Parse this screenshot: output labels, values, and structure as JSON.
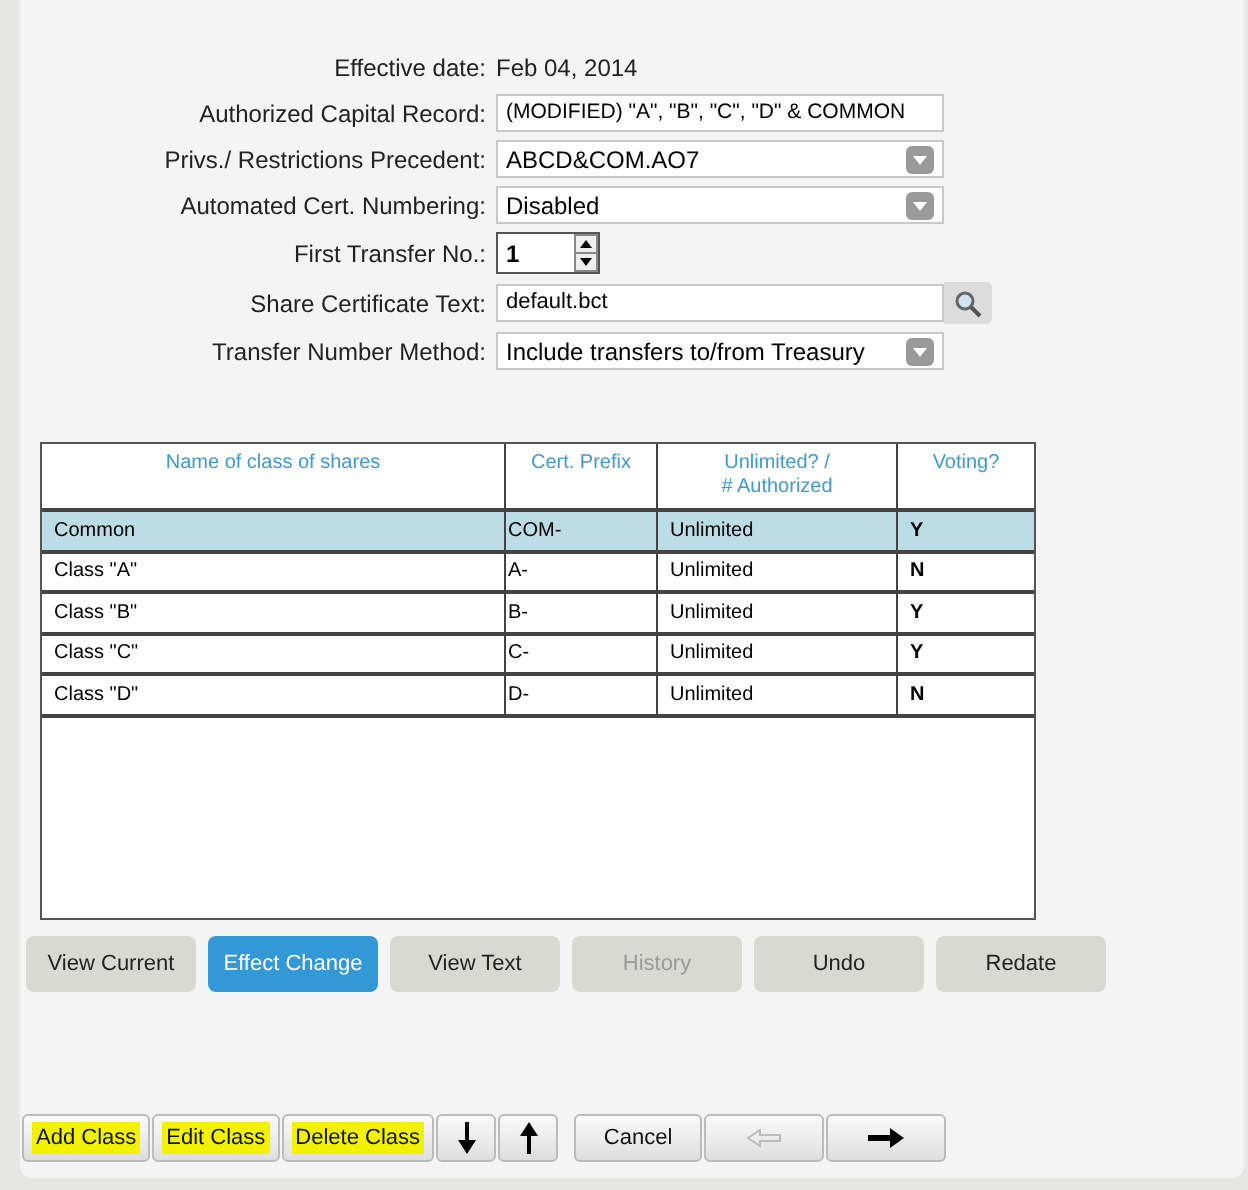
{
  "form": [
    {
      "label": "Effective date:",
      "kind": "static",
      "value": "Feb 04, 2014"
    },
    {
      "label": "Authorized Capital Record:",
      "kind": "text",
      "value": "(MODIFIED) \"A\", \"B\", \"C\", \"D\" & COMMON"
    },
    {
      "label": "Privs./ Restrictions Precedent:",
      "kind": "select",
      "value": "ABCD&COM.AO7"
    },
    {
      "label": "Automated Cert. Numbering:",
      "kind": "select",
      "value": "Disabled"
    },
    {
      "label": "First Transfer No.:",
      "kind": "spinner",
      "value": "1"
    },
    {
      "label": "Share Certificate Text:",
      "kind": "lookup",
      "value": "default.bct"
    },
    {
      "label": "Transfer Number Method:",
      "kind": "select",
      "value": "Include transfers to/from Treasury"
    }
  ],
  "table": {
    "columns": [
      "Name of class of shares",
      "Cert. Prefix",
      "Unlimited? /\n# Authorized",
      "Voting?"
    ],
    "rows": [
      {
        "selected": true,
        "cells": [
          "Common",
          "COM-",
          "Unlimited",
          "Y"
        ]
      },
      {
        "selected": false,
        "cells": [
          "Class \"A\"",
          "A-",
          "Unlimited",
          "N"
        ]
      },
      {
        "selected": false,
        "cells": [
          "Class \"B\"",
          "B-",
          "Unlimited",
          "Y"
        ]
      },
      {
        "selected": false,
        "cells": [
          "Class \"C\"",
          "C-",
          "Unlimited",
          "Y"
        ]
      },
      {
        "selected": false,
        "cells": [
          "Class \"D\"",
          "D-",
          "Unlimited",
          "N"
        ]
      }
    ]
  },
  "actions": [
    {
      "label": "View Current",
      "selected": false,
      "disabled": false
    },
    {
      "label": "Effect Change",
      "selected": true,
      "disabled": false
    },
    {
      "label": "View Text",
      "selected": false,
      "disabled": false
    },
    {
      "label": "History",
      "selected": false,
      "disabled": true
    },
    {
      "label": "Undo",
      "selected": false,
      "disabled": false
    },
    {
      "label": "Redate",
      "selected": false,
      "disabled": false
    }
  ],
  "bottom_buttons": [
    {
      "kind": "text",
      "label": "Add Class",
      "highlighted": true,
      "disabled": false
    },
    {
      "kind": "text",
      "label": "Edit Class",
      "highlighted": true,
      "disabled": false
    },
    {
      "kind": "text",
      "label": "Delete Class",
      "highlighted": true,
      "disabled": false
    },
    {
      "kind": "down"
    },
    {
      "kind": "up"
    },
    {
      "kind": "gap"
    },
    {
      "kind": "text",
      "label": "Cancel",
      "highlighted": false
    },
    {
      "kind": "left",
      "disabled": true
    },
    {
      "kind": "right"
    }
  ]
}
